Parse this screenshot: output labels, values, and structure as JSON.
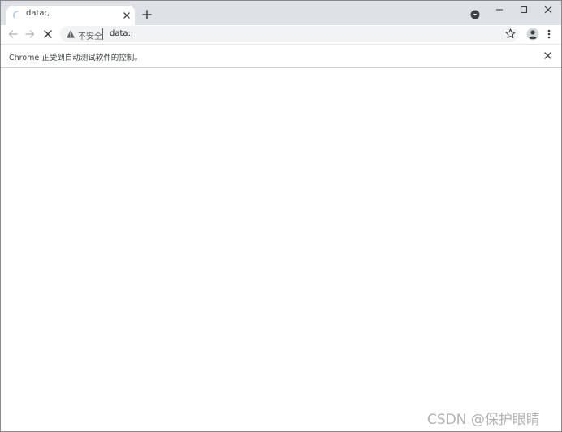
{
  "tabs": [
    {
      "title": "data:,",
      "loading": true
    }
  ],
  "omnibox": {
    "security_label": "不安全",
    "url": "data:,"
  },
  "infobar": {
    "message": "Chrome 正受到自动测试软件的控制。"
  },
  "watermark": "CSDN @保护眼睛",
  "icons": {
    "tab_spinner": "loading-spinner-icon",
    "tab_close": "close-icon",
    "new_tab": "plus-icon",
    "tab_search": "tab-search-icon",
    "minimize": "minimize-icon",
    "maximize": "maximize-icon",
    "close_window": "close-icon",
    "back": "arrow-left-icon",
    "forward": "arrow-right-icon",
    "stop": "stop-icon",
    "warning": "warning-icon",
    "bookmark": "star-icon",
    "profile": "profile-icon",
    "menu": "kebab-menu-icon",
    "infobar_close": "close-icon"
  },
  "colors": {
    "tabstrip": "#dee1e6",
    "omnibox": "#f1f3f4",
    "spinner": "#a5c8f5"
  }
}
